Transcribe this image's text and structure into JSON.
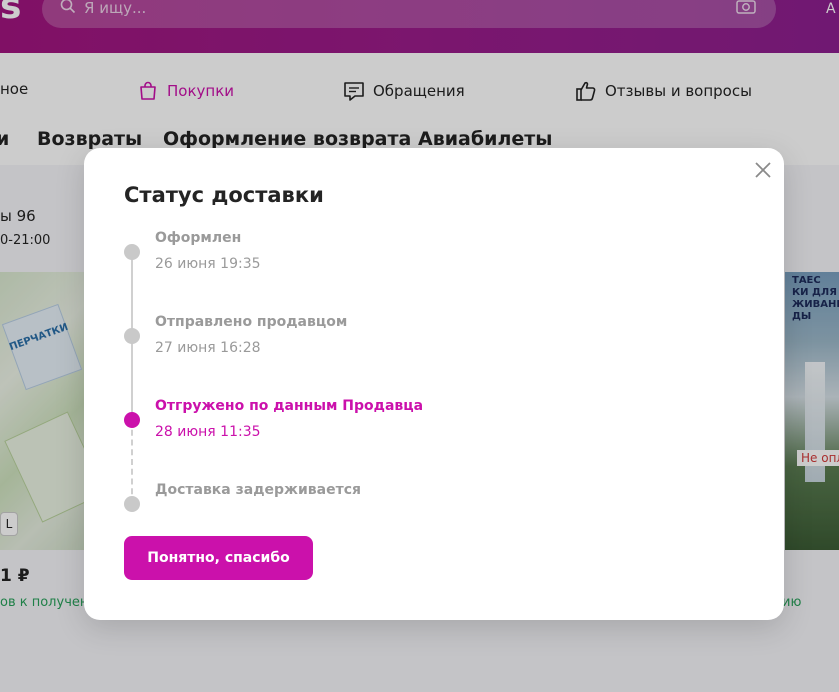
{
  "header": {
    "logo_fragment": "s",
    "search_placeholder": "Я ищу...",
    "right_fragment": "А"
  },
  "nav": {
    "items": [
      {
        "label": "ное"
      },
      {
        "label": "Покупки",
        "active": true
      },
      {
        "label": "Обращения"
      },
      {
        "label": "Отзывы и вопросы"
      }
    ]
  },
  "subtabs": [
    {
      "label": "и"
    },
    {
      "label": "Возвраты"
    },
    {
      "label": "Оформление возврата"
    },
    {
      "label": "Авиабилеты"
    }
  ],
  "background": {
    "address_line": "ы 96",
    "hours_line": "0-21:00",
    "left_product_label": "ПЕРЧАТКИ",
    "size_badge": "L",
    "left_price": "1 ₽",
    "left_delivery": "ов к получен",
    "right_product_text": "ТАЕС\nКИ ДЛЯ\nЖИВАНИЯ\nДЫ",
    "right_badge": "Не опл",
    "right_delivery": "ию"
  },
  "modal": {
    "title": "Статус доставки",
    "close_label": "×",
    "steps": [
      {
        "title": "Оформлен",
        "date": "26 июня 19:35",
        "state": "done"
      },
      {
        "title": "Отправлено продавцом",
        "date": "27 июня 16:28",
        "state": "done"
      },
      {
        "title": "Отгружено по данным Продавца",
        "date": "28 июня 11:35",
        "state": "current"
      },
      {
        "title": "Доставка задерживается",
        "date": "",
        "state": "pending"
      }
    ],
    "button_label": "Понятно, спасибо"
  },
  "colors": {
    "accent": "#cb11ab",
    "header_bg": "#9a1c8a",
    "muted": "#9a9a9a",
    "delivery_green": "#27a05a"
  }
}
